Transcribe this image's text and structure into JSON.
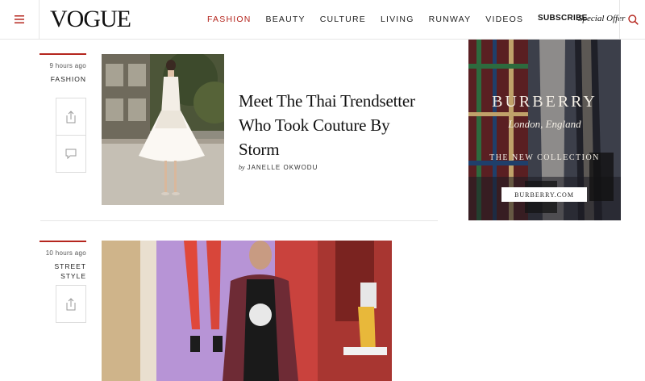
{
  "header": {
    "logo": "VOGUE",
    "nav": [
      "FASHION",
      "BEAUTY",
      "CULTURE",
      "LIVING",
      "RUNWAY",
      "VIDEOS"
    ],
    "active_nav": "FASHION",
    "subscribe_label": "SUBSCRIBE",
    "offer_label": "Special Offer",
    "menu_icon": "hamburger-menu-icon",
    "search_icon": "search-icon"
  },
  "articles": [
    {
      "time": "9 hours ago",
      "category": "FASHION",
      "headline": "Meet The Thai Trendsetter Who Took Couture By Storm",
      "byline_prefix": "by",
      "author": "JANELLE OKWODU",
      "actions": [
        "share-icon",
        "comment-icon"
      ]
    },
    {
      "time": "10 hours ago",
      "category": "STREET STYLE",
      "actions": [
        "share-icon"
      ]
    }
  ],
  "ad": {
    "brand": "BURBERRY",
    "city": "London, England",
    "collection": "THE NEW COLLECTION",
    "cta": "BURBERRY.COM"
  },
  "colors": {
    "accent": "#b5261e",
    "divider": "#e6e6e6",
    "text": "#111111"
  }
}
